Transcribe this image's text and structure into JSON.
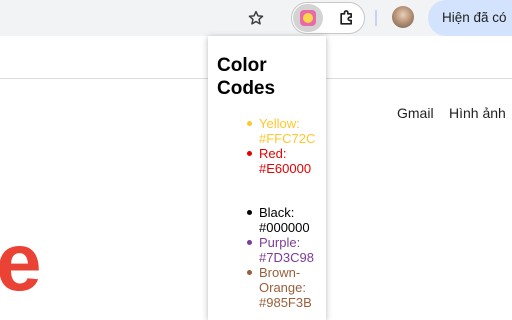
{
  "browser": {
    "update_button_label": "Hiện đã có",
    "icons": [
      "star-icon",
      "color-codes-extension-icon",
      "puzzle-extensions-icon",
      "profile-avatar"
    ]
  },
  "page": {
    "links": {
      "gmail": "Gmail",
      "images": "Hình ảnh"
    },
    "logo_letter": "e"
  },
  "popup": {
    "title_line1": "Color",
    "title_line2": "Codes",
    "colors_group1": [
      {
        "name": "Yellow:",
        "code": "#FFC72C",
        "color": "#FFC72C"
      },
      {
        "name": "Red:",
        "code": "#E60000",
        "color": "#E60000"
      }
    ],
    "colors_group2": [
      {
        "name": "Black:",
        "code": "#000000",
        "color": "#000000"
      },
      {
        "name": "Purple:",
        "code": "#7D3C98",
        "color": "#7D3C98"
      },
      {
        "name_line1": "Brown-",
        "name_line2": "Orange:",
        "code": "#985F3B",
        "color": "#985F3B"
      }
    ]
  }
}
